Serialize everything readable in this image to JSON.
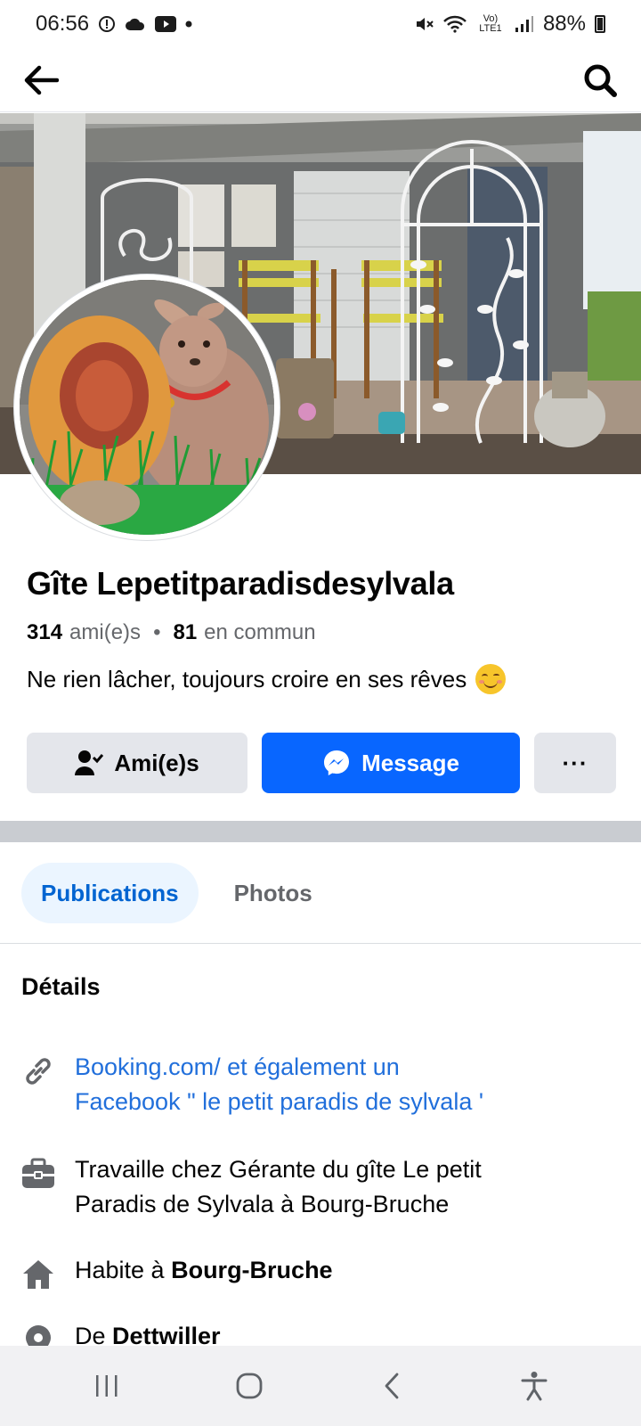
{
  "status_bar": {
    "time": "06:56",
    "battery": "88%",
    "network": "Vo) LTE1"
  },
  "header": {
    "back_icon": "arrow-left-icon",
    "search_icon": "search-icon"
  },
  "profile": {
    "name": "Gîte Lepetitparadisdesylvala",
    "friends_count": "314",
    "friends_label": "ami(e)s",
    "separator": "•",
    "mutual_count": "81",
    "mutual_label": "en commun",
    "bio": "Ne rien lâcher, toujours croire en ses rêves"
  },
  "actions": {
    "friends_label": "Ami(e)s",
    "message_label": "Message",
    "more_label": "···"
  },
  "tabs": [
    {
      "label": "Publications",
      "active": true
    },
    {
      "label": "Photos",
      "active": false
    }
  ],
  "details": {
    "title": "Détails",
    "link_line1": "Booking.com/  et également un",
    "link_line2": "Facebook \" le petit paradis de sylvala '",
    "work_line1": "Travaille chez Gérante du gîte Le petit",
    "work_line2": "Paradis de Sylvala à Bourg-Bruche",
    "lives_prefix": "Habite à ",
    "lives_place": "Bourg-Bruche",
    "from_prefix": "De ",
    "from_place": "Dettwiller"
  },
  "colors": {
    "accent": "#0866ff",
    "link": "#216fdb",
    "tab_active_bg": "#ebf5ff",
    "tab_active_text": "#0064d1",
    "secondary_text": "#65676b",
    "button_gray": "#e4e6eb"
  }
}
